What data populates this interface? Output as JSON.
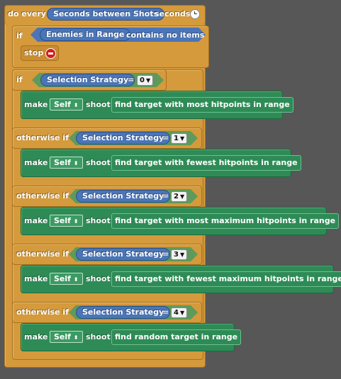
{
  "script": {
    "hat": {
      "do_every": "do every",
      "interval_var": "Seconds between Shots",
      "seconds": "seconds"
    },
    "stop_check": {
      "if": "if",
      "list_var": "Enemies in Range",
      "contains_no_items": "contains no items",
      "stop": "stop"
    },
    "branches": [
      {
        "keyword": "if",
        "var": "Selection Strategy",
        "op": "=",
        "value": "0",
        "make": "make",
        "self": "Self",
        "shoot": "shoot",
        "target": "find target with most hitpoints in range"
      },
      {
        "keyword": "otherwise if",
        "var": "Selection Strategy",
        "op": "=",
        "value": "1",
        "make": "make",
        "self": "Self",
        "shoot": "shoot",
        "target": "find target with fewest hitpoints in range"
      },
      {
        "keyword": "otherwise if",
        "var": "Selection Strategy",
        "op": "=",
        "value": "2",
        "make": "make",
        "self": "Self",
        "shoot": "shoot",
        "target": "find target with most maximum hitpoints in range"
      },
      {
        "keyword": "otherwise if",
        "var": "Selection Strategy",
        "op": "=",
        "value": "3",
        "make": "make",
        "self": "Self",
        "shoot": "shoot",
        "target": "find target with fewest maximum hitpoints in range"
      },
      {
        "keyword": "otherwise if",
        "var": "Selection Strategy",
        "op": "=",
        "value": "4",
        "make": "make",
        "self": "Self",
        "shoot": "shoot",
        "target": "find random target in range"
      }
    ]
  },
  "colors": {
    "control": "#d49a3c",
    "action": "#2e8b56",
    "variable": "#4a75b8",
    "background": "#575757"
  }
}
